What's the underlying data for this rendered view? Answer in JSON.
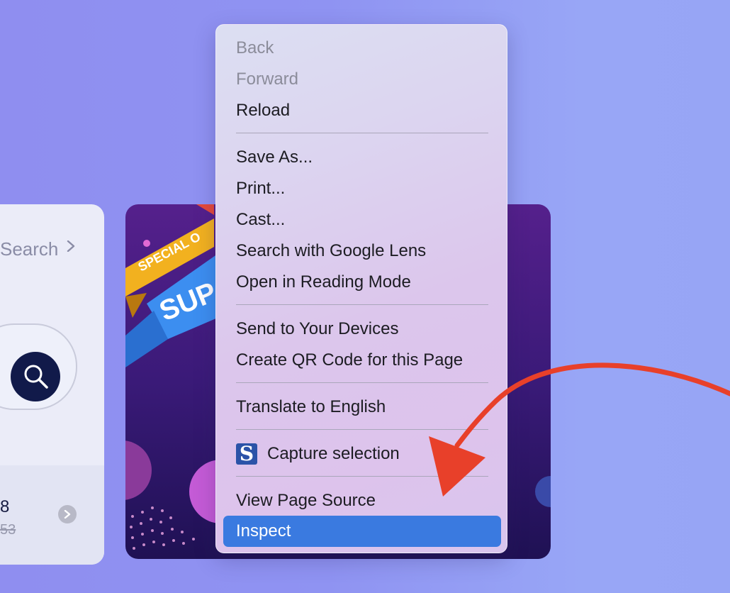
{
  "left_card": {
    "search_link": "Search",
    "price": "8",
    "old_price": "53"
  },
  "promo": {
    "badge_text": "SPECIAL O",
    "ribbon_text": "SUP"
  },
  "context_menu": {
    "items": [
      {
        "label": "Back",
        "enabled": false
      },
      {
        "label": "Forward",
        "enabled": false
      },
      {
        "label": "Reload",
        "enabled": true
      },
      {
        "label": "Save As...",
        "enabled": true
      },
      {
        "label": "Print...",
        "enabled": true
      },
      {
        "label": "Cast...",
        "enabled": true
      },
      {
        "label": "Search with Google Lens",
        "enabled": true
      },
      {
        "label": "Open in Reading Mode",
        "enabled": true
      },
      {
        "label": "Send to Your Devices",
        "enabled": true
      },
      {
        "label": "Create QR Code for this Page",
        "enabled": true
      },
      {
        "label": "Translate to English",
        "enabled": true
      },
      {
        "label": "Capture selection",
        "enabled": true,
        "icon": "snagit-s-icon"
      },
      {
        "label": "View Page Source",
        "enabled": true
      },
      {
        "label": "Inspect",
        "enabled": true,
        "highlighted": true
      }
    ],
    "capture_icon_letter": "S"
  },
  "colors": {
    "highlight": "#3a7ae0",
    "arrow": "#e8402a",
    "background": "#8f93f2"
  }
}
